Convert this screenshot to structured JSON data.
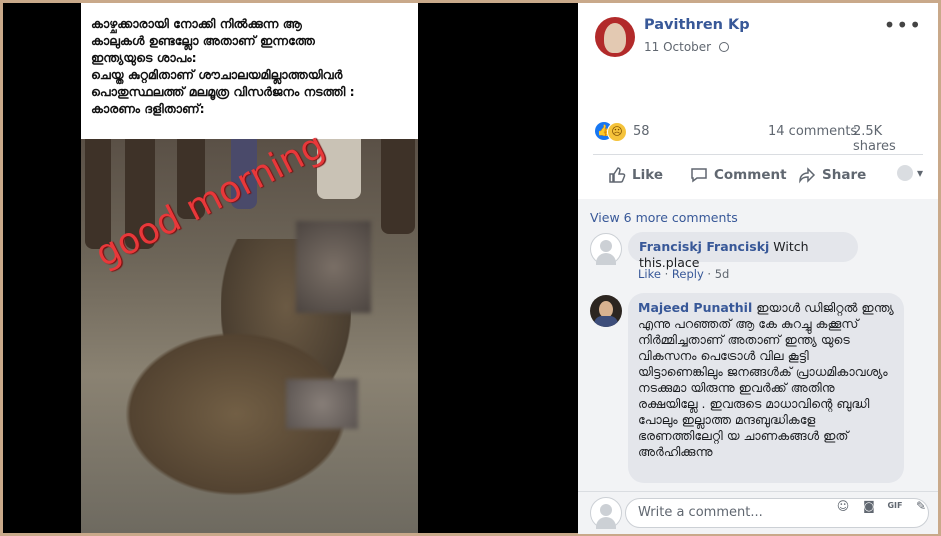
{
  "photo": {
    "caption_lines": [
      "കാഴ്ചക്കാരായി നോക്കി നിൽക്കുന്ന ആ",
      "കാലുകൾ ഉണ്ടല്ലോ അതാണ് ഇന്നത്തേ",
      "ഇന്ത്യയുടെ ശാപം:",
      "ചെയ്ത കുറ്റമിതാണ് ശൗചാലയമില്ലാത്തയിവർ",
      "പൊതുസ്ഥലത്ത് മലമൂത്ര വിസർജനം നടത്തി :",
      "കാരണം ദളിതാണ്:"
    ],
    "overlay_text": "good morning"
  },
  "post": {
    "author": "Pavithren Kp",
    "date": "11 October",
    "reaction_count": "58",
    "comment_count": "14 comments",
    "share_count": "2.5K shares",
    "actions": {
      "like": "Like",
      "comment": "Comment",
      "share": "Share"
    }
  },
  "comments": {
    "view_more": "View 6 more comments",
    "items": [
      {
        "author": "Franciskj Franciskj",
        "text": "Witch this.place",
        "like": "Like",
        "reply": "Reply",
        "time": "5d"
      },
      {
        "author": "Majeed Punathil",
        "text": "ഇയാൾ ഡിജിറ്റൽ ഇന്ത്യ എന്നു പറഞ്ഞത് ആ കേ കുറച്ചു കക്കൂസ് നിർമ്മിച്ചതാണ് അതാണ് ഇന്ത്യ യുടെ വികസനം പെട്രോൾ വില കൂട്ടി യിട്ടാണെങ്കിലും ജനങ്ങൾക് പ്രാധമികാവശ്യം നടക്കുമാ യിരുന്നു ഇവർക്ക് അതിനു രക്ഷയില്ലേ . ഇവരുടെ മാധാവിന്റെ ബുദ്ധി പോലും ഇല്ലാത്ത മന്ദബുദ്ധികളേ ഭരണത്തിലേറ്റി യ ചാണകങ്ങൾ ഇത് അർഹിക്കുന്നു"
      }
    ]
  },
  "composer": {
    "placeholder": "Write a comment..."
  },
  "icons": {
    "more": "more-options-icon",
    "globe": "globe-icon",
    "like_reaction": "like-reaction-icon",
    "sad_reaction": "sad-reaction-icon",
    "emoji": "emoji-icon",
    "camera": "camera-icon",
    "gif": "gif-icon",
    "sticker": "sticker-icon"
  },
  "colors": {
    "link_blue": "#385898",
    "like_blue": "#1877f2",
    "overlay_red": "#e8383a",
    "frame": "#c9a98a"
  }
}
